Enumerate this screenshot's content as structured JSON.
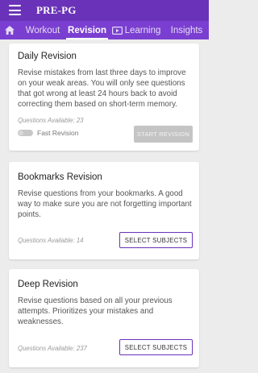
{
  "header": {
    "title": "PRE-PG",
    "menu_icon": "menu-icon",
    "background": "#6a32b8"
  },
  "tabs": {
    "background": "#7a3fd0",
    "home_icon": "home-icon",
    "items": [
      {
        "label": "Workout",
        "active": false
      },
      {
        "label": "Revision",
        "active": true
      },
      {
        "label": "Learning",
        "active": false,
        "icon": "play-icon"
      },
      {
        "label": "Insights",
        "active": false
      }
    ]
  },
  "cards": {
    "daily": {
      "title": "Daily Revision",
      "description": "Revise mistakes from last three days to improve on your weak areas. You will only see questions that got wrong at least 24 hours back to avoid correcting them based on short-term memory.",
      "available": "Questions Available: 23",
      "toggle_label": "Fast Revision",
      "toggle_on": false,
      "button": "START REVISION",
      "button_enabled": false
    },
    "bookmarks": {
      "title": "Bookmarks Revision",
      "description": "Revise questions from your bookmarks. A good way to make sure you are not forgetting important points.",
      "available": "Questions Available: 14",
      "button": "SELECT SUBJECTS"
    },
    "deep": {
      "title": "Deep Revision",
      "description": "Revise questions based on all your previous attempts. Prioritizes your mistakes and weaknesses.",
      "available": "Questions Available: 237",
      "button": "SELECT SUBJECTS"
    }
  },
  "colors": {
    "accent": "#6a32b8",
    "page_background": "#ececec",
    "disabled_button": "#c4c4c4"
  }
}
